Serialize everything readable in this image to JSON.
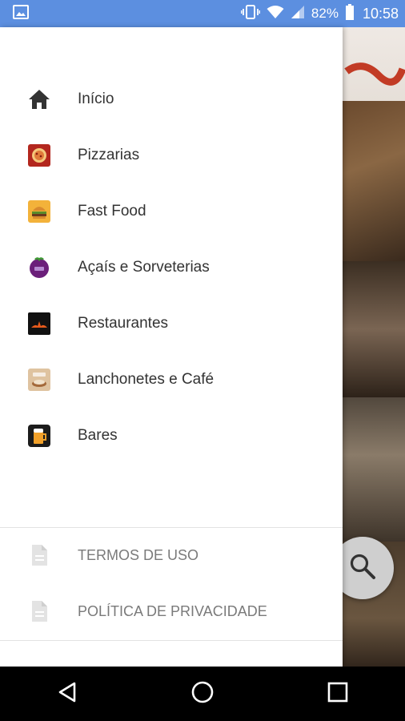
{
  "status_bar": {
    "battery_percent": "82%",
    "time": "10:58",
    "icons": [
      "image-icon",
      "vibrate-icon",
      "wifi-icon",
      "signal-icon",
      "battery-icon"
    ]
  },
  "drawer": {
    "menu_items": [
      {
        "label": "Início",
        "icon": "home-icon"
      },
      {
        "label": "Pizzarias",
        "icon": "pizza-icon"
      },
      {
        "label": "Fast Food",
        "icon": "burger-icon"
      },
      {
        "label": "Açaís e Sorveterias",
        "icon": "acai-icon"
      },
      {
        "label": "Restaurantes",
        "icon": "restaurant-icon"
      },
      {
        "label": "Lanchonetes e Café",
        "icon": "cafe-icon"
      },
      {
        "label": "Bares",
        "icon": "beer-icon"
      }
    ],
    "footer_items": [
      {
        "label": "TERMOS DE USO",
        "icon": "document-icon"
      },
      {
        "label": "POLÍTICA DE PRIVACIDADE",
        "icon": "document-icon"
      }
    ]
  },
  "fab": {
    "icon": "search-icon"
  },
  "nav_bar": {
    "icons": [
      "back-icon",
      "home-circle-icon",
      "recents-icon"
    ]
  }
}
